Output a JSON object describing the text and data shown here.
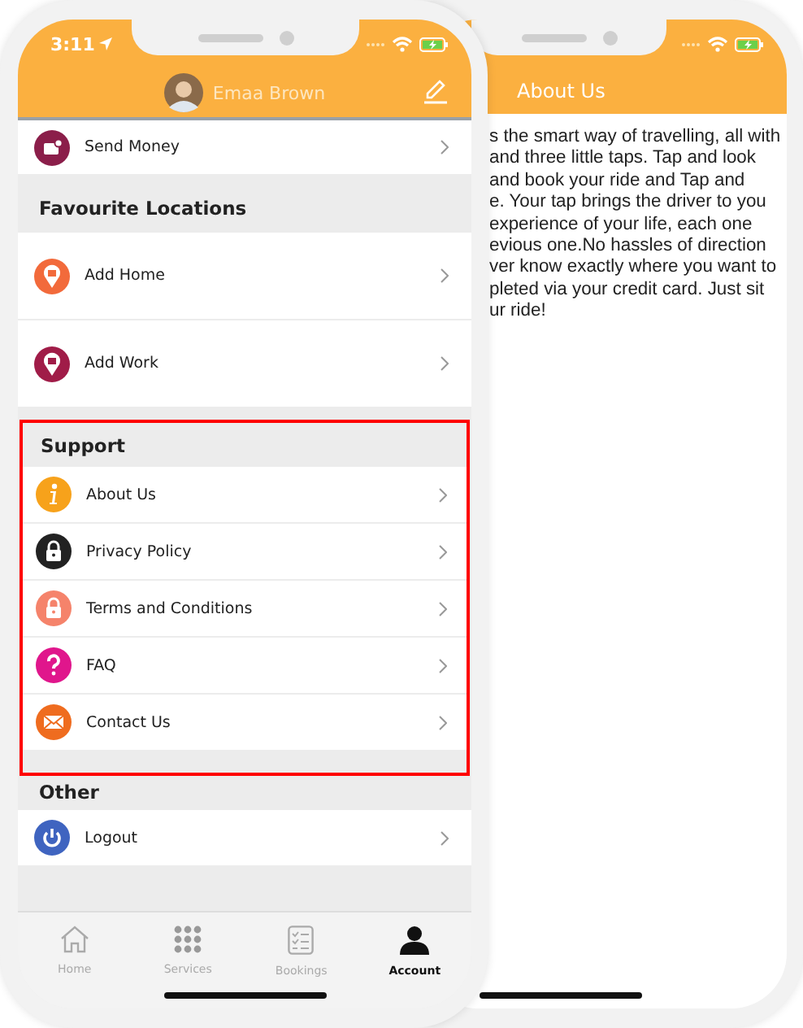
{
  "front_phone": {
    "status_bar": {
      "time": "3:11"
    },
    "header": {
      "user_name": "Emaa Brown"
    },
    "top_rows": [
      {
        "label": "Send Money",
        "color": "#8b1e4a"
      }
    ],
    "sections": [
      {
        "title": "Favourite Locations",
        "highlighted": false,
        "items": [
          {
            "label": "Add Home",
            "color": "#f26a3b"
          },
          {
            "label": "Add Work",
            "color": "#a01c48"
          }
        ]
      },
      {
        "title": "Support",
        "highlighted": true,
        "items": [
          {
            "label": "About Us",
            "color": "#f7a21b"
          },
          {
            "label": "Privacy Policy",
            "color": "#222222"
          },
          {
            "label": "Terms and Conditions",
            "color": "#f5836b"
          },
          {
            "label": "FAQ",
            "color": "#e0168c"
          },
          {
            "label": "Contact Us",
            "color": "#ef6c1f"
          }
        ]
      },
      {
        "title": "Other",
        "highlighted": false,
        "items": [
          {
            "label": "Logout",
            "color": "#3f64c0"
          }
        ]
      }
    ],
    "tab_bar": [
      {
        "label": "Home",
        "selected": false
      },
      {
        "label": "Services",
        "selected": false
      },
      {
        "label": "Bookings",
        "selected": false
      },
      {
        "label": "Account",
        "selected": true
      }
    ]
  },
  "back_phone": {
    "header": {
      "title": "About Us"
    },
    "text_lines": [
      "s the smart way of travelling, all with",
      "and three little taps. Tap and look",
      "and book your ride and Tap and",
      "e. Your tap brings the driver to you",
      "experience of your life, each one",
      "evious one.No hassles of direction",
      "ver know exactly where you want to",
      "pleted via your credit card. Just sit",
      "ur ride!"
    ]
  }
}
